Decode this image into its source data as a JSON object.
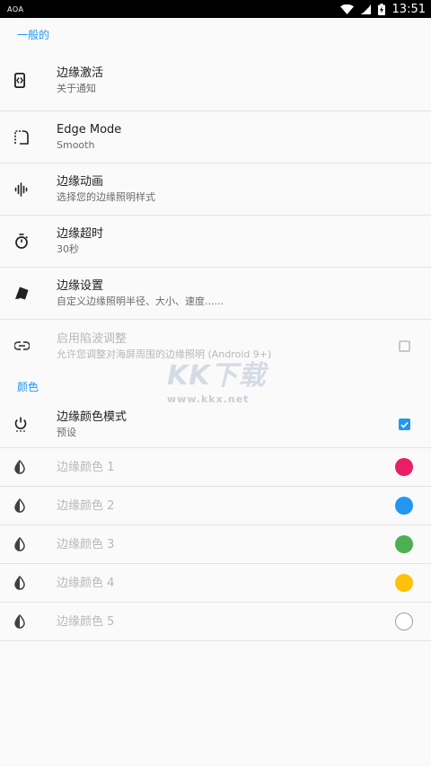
{
  "status_bar": {
    "app_label": "AOA",
    "time": "13:51"
  },
  "sections": {
    "general": {
      "title": "一般的"
    },
    "colors": {
      "title": "颜色"
    }
  },
  "general_items": [
    {
      "icon": "edge-lighting-icon",
      "title": "边缘激活",
      "subtitle": "关于通知"
    },
    {
      "icon": "edge-mode-icon",
      "title": "Edge Mode",
      "subtitle": "Smooth"
    },
    {
      "icon": "waveform-icon",
      "title": "边缘动画",
      "subtitle": "选择您的边缘照明样式"
    },
    {
      "icon": "timer-icon",
      "title": "边缘超时",
      "subtitle": "30秒"
    },
    {
      "icon": "brush-icon",
      "title": "边缘设置",
      "subtitle": "自定义边缘照明半径、大小、速度......"
    },
    {
      "icon": "link-icon",
      "title": "启用陷波调整",
      "subtitle": "允许您调整对海屏周围的边缘照明 (Android 9+)",
      "checked": false,
      "disabled": true
    }
  ],
  "color_mode": {
    "icon": "power-icon",
    "title": "边缘颜色模式",
    "subtitle": "预设",
    "checked": true
  },
  "color_items": [
    {
      "label": "边缘颜色 1",
      "color": "#e91e63"
    },
    {
      "label": "边缘颜色 2",
      "color": "#2196f3"
    },
    {
      "label": "边缘颜色 3",
      "color": "#4caf50"
    },
    {
      "label": "边缘颜色 4",
      "color": "#ffc107"
    },
    {
      "label": "边缘颜色 5",
      "color": "#ffffff"
    }
  ],
  "watermark": {
    "brand": "KK下载",
    "url": "www.kkx.net"
  },
  "accent_color": "#2196f3"
}
